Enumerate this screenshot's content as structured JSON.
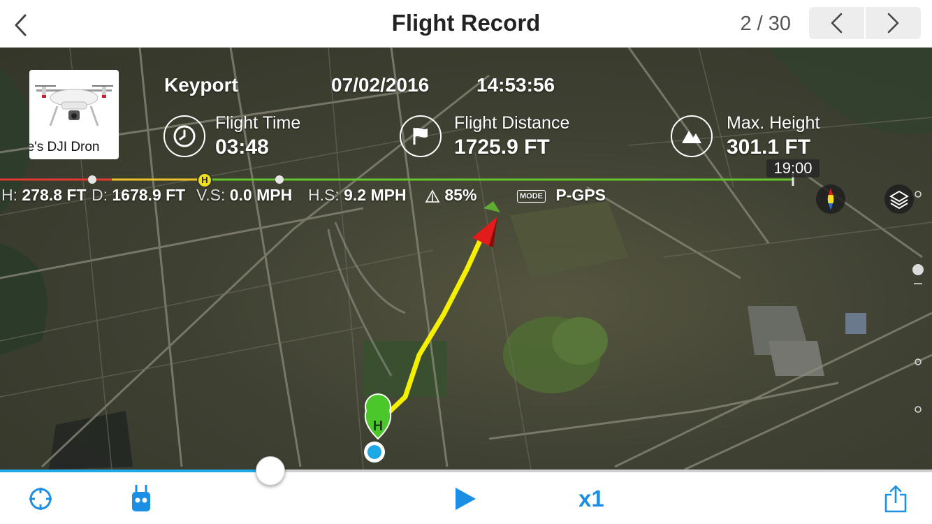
{
  "header": {
    "title": "Flight Record",
    "counter": "2 / 30"
  },
  "flight": {
    "aircraft_name": "ge's DJI Dron",
    "location": "Keyport",
    "date": "07/02/2016",
    "time": "14:53:56",
    "stats": {
      "flight_time_label": "Flight Time",
      "flight_time_value": "03:48",
      "distance_label": "Flight Distance",
      "distance_value": "1725.9 FT",
      "height_label": "Max. Height",
      "height_value": "301.1 FT"
    }
  },
  "timeline": {
    "time_badge": "19:00",
    "home_marker": "H"
  },
  "telemetry": {
    "h_label": "H:",
    "h_value": "278.8 FT",
    "d_label": "D:",
    "d_value": "1678.9 FT",
    "vs_label": "V.S:",
    "vs_value": "0.0 MPH",
    "hs_label": "H.S:",
    "hs_value": "9.2 MPH",
    "battery_value": "85%",
    "mode_badge": "MODE",
    "mode_value": "P-GPS"
  },
  "map": {
    "home_point": "H",
    "colors": {
      "flight_path": "#f5f000",
      "home_marker": "#4cc72b",
      "aircraft_arrow": "#e21b1b",
      "start_dot": "#1ea8e6"
    }
  },
  "playback": {
    "speed_label": "x1",
    "progress": 0.29,
    "accent_color": "#1ea8e6"
  }
}
